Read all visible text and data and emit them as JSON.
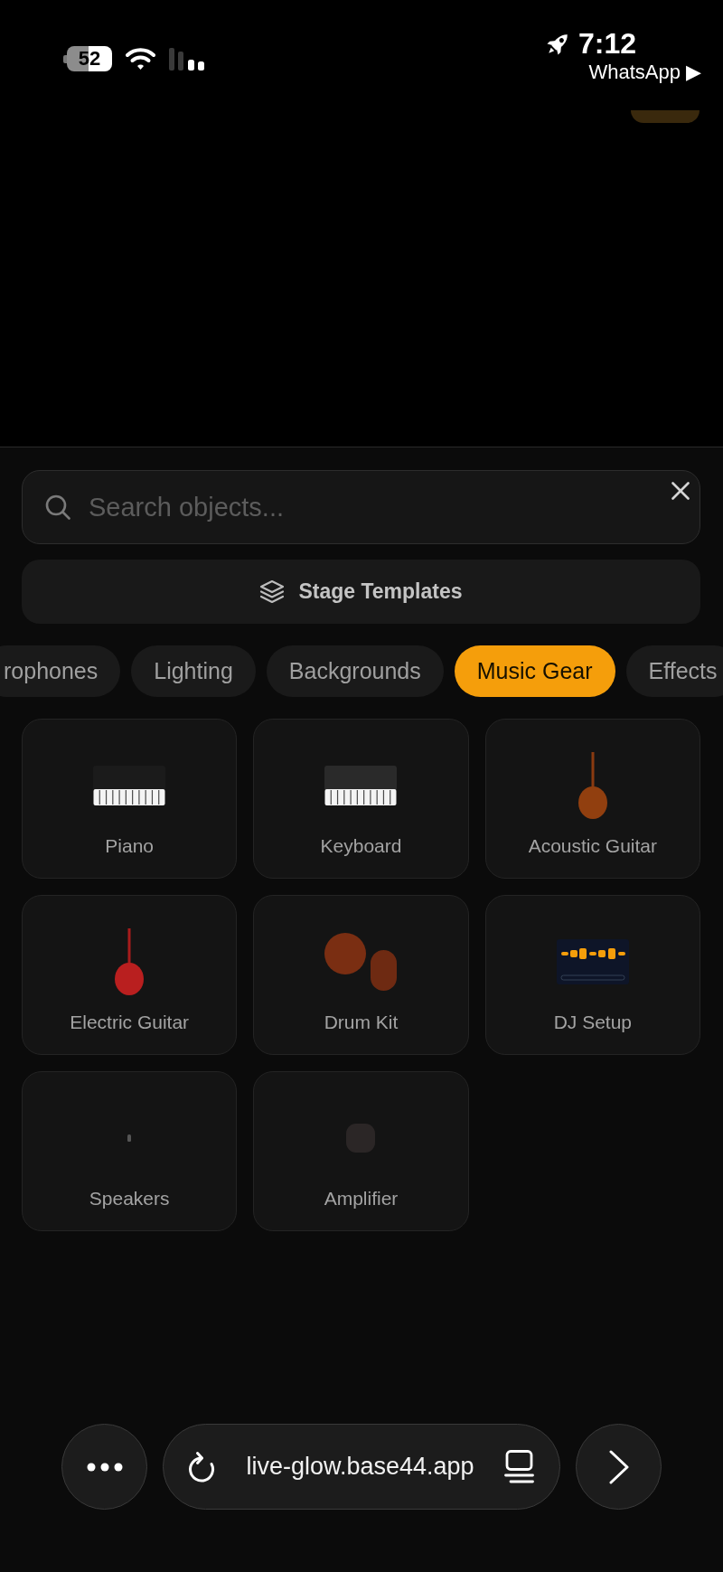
{
  "status_bar": {
    "battery": "52",
    "time": "7:12",
    "back_link": "WhatsApp ▶"
  },
  "search": {
    "placeholder": "Search objects..."
  },
  "templates_button": {
    "label": "Stage Templates"
  },
  "tabs": [
    {
      "label": "rophones",
      "selected": false
    },
    {
      "label": "Lighting",
      "selected": false
    },
    {
      "label": "Backgrounds",
      "selected": false
    },
    {
      "label": "Music Gear",
      "selected": true
    },
    {
      "label": "Effects",
      "selected": false
    }
  ],
  "objects": [
    {
      "label": "Piano",
      "kind": "piano"
    },
    {
      "label": "Keyboard",
      "kind": "keyboard"
    },
    {
      "label": "Acoustic Guitar",
      "kind": "acoustic_guitar"
    },
    {
      "label": "Electric Guitar",
      "kind": "electric_guitar"
    },
    {
      "label": "Drum Kit",
      "kind": "drum_kit"
    },
    {
      "label": "DJ Setup",
      "kind": "dj_setup"
    },
    {
      "label": "Speakers",
      "kind": "speakers"
    },
    {
      "label": "Amplifier",
      "kind": "amplifier"
    }
  ],
  "browser_bar": {
    "url": "live-glow.base44.app"
  }
}
